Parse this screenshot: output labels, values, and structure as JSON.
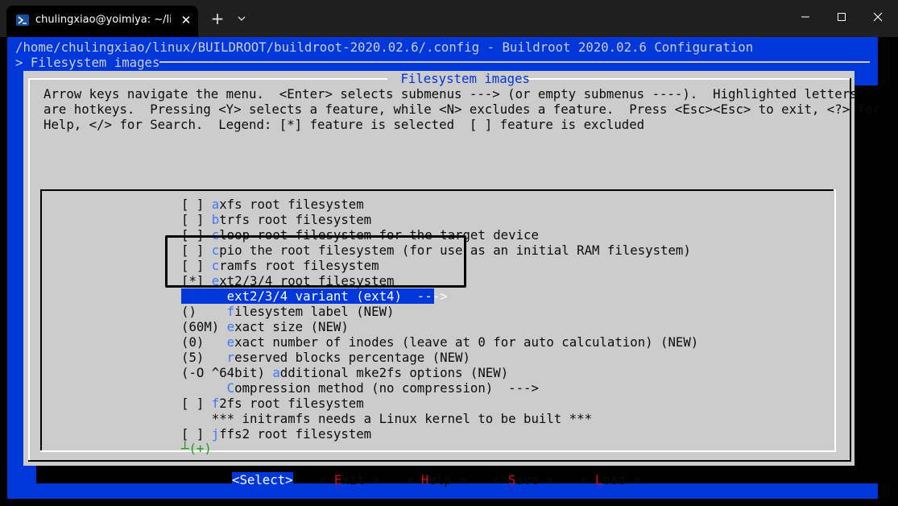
{
  "window": {
    "tab_title": "chulingxiao@yoimiya: ~/linux",
    "tab_close": "✕",
    "new_tab": "+",
    "icons": [
      "powershell-icon",
      "chevron-down-icon",
      "minimize-icon",
      "maximize-icon",
      "close-icon"
    ]
  },
  "terminal": {
    "header_path": "/home/chulingxiao/linux/BUILDROOT/buildroot-2020.02.6/.config - Buildroot 2020.02.6 Configuration",
    "header_breadcrumb": "> Filesystem images",
    "dialog_title": " Filesystem images ",
    "help_lines": [
      "Arrow keys navigate the menu.  <Enter> selects submenus ---> (or empty submenus ----).  Highlighted letters",
      "are hotkeys.  Pressing <Y> selects a feature, while <N> excludes a feature.  Press <Esc><Esc> to exit, <?> for",
      "Help, </> for Search.  Legend: [*] feature is selected  [ ] feature is excluded"
    ],
    "menu_items": [
      {
        "prefix": "[ ] ",
        "hotkey": "a",
        "rest": "xfs root filesystem"
      },
      {
        "prefix": "[ ] ",
        "hotkey": "b",
        "rest": "trfs root filesystem"
      },
      {
        "prefix": "[ ] ",
        "hotkey": "c",
        "rest": "loop root filesystem for the target device"
      },
      {
        "prefix": "[ ] ",
        "hotkey": "c",
        "rest": "pio the root filesystem (for use as an initial RAM filesystem)"
      },
      {
        "prefix": "[ ] ",
        "hotkey": "c",
        "rest": "ramfs root filesystem"
      },
      {
        "prefix": "[*] ",
        "hotkey": "e",
        "rest": "xt2/3/4 root filesystem"
      },
      {
        "prefix": "      ",
        "hotkey": "",
        "rest": "ext2/3/4 variant (ext4)  --->"
      },
      {
        "prefix": "()    ",
        "hotkey": "f",
        "rest": "ilesystem label (NEW)"
      },
      {
        "prefix": "(60M) ",
        "hotkey": "e",
        "rest": "xact size (NEW)"
      },
      {
        "prefix": "(0)   ",
        "hotkey": "e",
        "rest": "xact number of inodes (leave at 0 for auto calculation) (NEW)"
      },
      {
        "prefix": "(5)   ",
        "hotkey": "r",
        "rest": "eserved blocks percentage (NEW)"
      },
      {
        "prefix": "(-O ^64bit) ",
        "hotkey": "a",
        "rest": "dditional mke2fs options (NEW)"
      },
      {
        "prefix": "      ",
        "hotkey": "C",
        "rest": "ompression method (no compression)  --->"
      },
      {
        "prefix": "[ ] ",
        "hotkey": "f",
        "rest": "2fs root filesystem"
      },
      {
        "prefix": "    ",
        "hotkey": "",
        "rest": "*** initramfs needs a Linux kernel to be built ***"
      },
      {
        "prefix": "[ ] ",
        "hotkey": "j",
        "rest": "ffs2 root filesystem"
      }
    ],
    "more_indicator": "┴(+)",
    "buttons": {
      "select": "<Select>",
      "exit_pre": "< ",
      "exit_hk": "E",
      "exit_rest": "xit >",
      "help_pre": "< ",
      "help_hk": "H",
      "help_rest": "elp >",
      "save_pre": "< ",
      "save_hk": "S",
      "save_rest": "ave >",
      "load_pre": "< ",
      "load_hk": "L",
      "load_rest": "oad >"
    },
    "colors": {
      "background_blue": "#0037da",
      "dialog_gray": "#cccccc",
      "hotkey_blue": "#3b78ff",
      "hotkey_red": "#c50f1f",
      "more_green": "#13a10e"
    }
  }
}
